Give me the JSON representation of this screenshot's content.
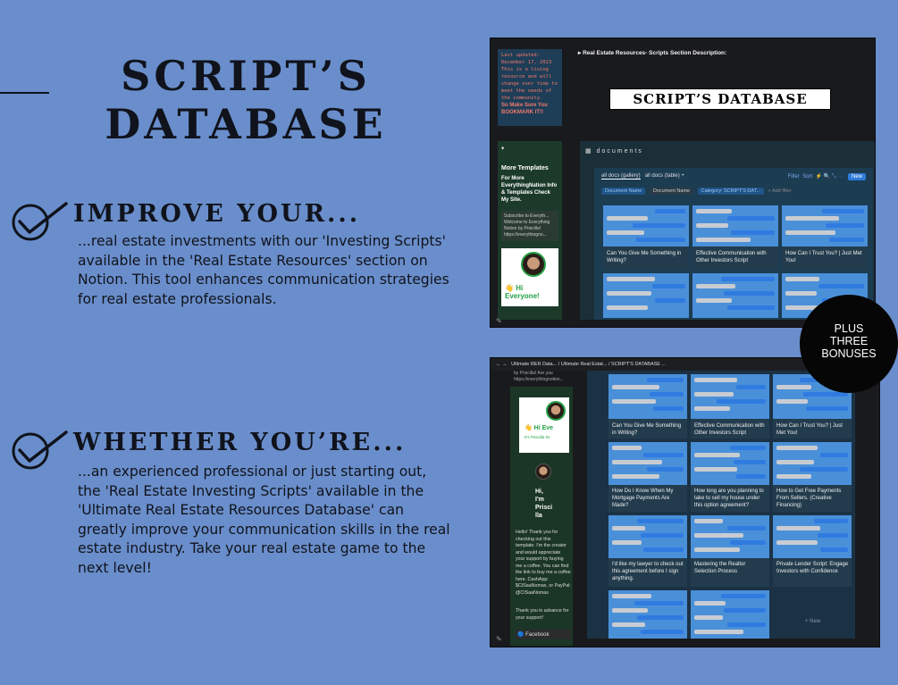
{
  "title_lines": [
    "SCRIPT’S",
    "DATABASE"
  ],
  "features": [
    {
      "heading": "IMPROVE YOUR...",
      "body_lines": [
        "...real estate investments with our 'Investing Scripts'",
        "available in the 'Real Estate Resources' section on",
        "Notion. This tool enhances communication strategies",
        "for real estate professionals."
      ]
    },
    {
      "heading": "WHETHER YOU’RE...",
      "body_lines": [
        "...an experienced professional or just starting out,",
        "the 'Real Estate Investing Scripts' available in the",
        "'Ultimate Real Estate Resources Database' can",
        "greatly improve your communication skills in the real",
        "estate industry. Take your real estate game to the",
        "next level!"
      ]
    }
  ],
  "badge_lines": [
    "PLUS",
    "THREE",
    "BONUSES"
  ],
  "shot1": {
    "notice_lines": [
      "Last updated:",
      "December 17, 2023",
      "This is a living",
      "resource and will",
      "change over time to",
      "meet the needs of",
      "the community.",
      "So Make Sure You",
      "BOOKMARK IT!!"
    ],
    "section_toggle": "Real Estate Resources- Scripts Section Description:",
    "banner": "SCRIPT’S DATABASE",
    "sidebar_heading": "More Templates",
    "sidebar_text": "For More EverythingNation Info & Templates Check My Site.",
    "sidebar_box": [
      "Subscribe to Everyth...",
      "Welcome to Everything",
      "Notion by Priscilla!",
      "https://everythingno..."
    ],
    "sidebar_greeting": "Hi Everyone!",
    "docs_title": "documents",
    "tabs": [
      "all docs (gallery)",
      "all docs (table)"
    ],
    "toolbar": [
      "Filter",
      "Sort"
    ],
    "new_button": "New",
    "filters": [
      "Document Name",
      "Document Name",
      "Category: SCRIPT'S DAT...",
      "+ Add filter"
    ],
    "cards": [
      "Can You Give Me Something in Writing?",
      "Effective Communication with Other Investors Script",
      "How Can I Trust You? | Just Met You!"
    ]
  },
  "shot2": {
    "breadcrumbs": [
      "Ultimate RER Data...",
      "Ultimate Real Estat...",
      "SCRIPT'S DATABASE ..."
    ],
    "side_lines": [
      "by Priscilla! Are you",
      "https://everythingnotion..."
    ],
    "hi_text": [
      "Hi,",
      "I'm",
      "Prisci",
      "lla"
    ],
    "side_greeting": "Hi Eve",
    "side_sub": "It's Priscilla he",
    "thanks": "Hello! Thank you for checking out this template. I'm the creator and would appreciate your support by buying me a coffee. You can find the link to buy me a coffee here. CashApp: $CISaaNomas, or PayPal: @CISaaNomas",
    "thanks_end": "Thank you in advance for your support!",
    "facebook": "Facebook",
    "add_new": "+ New",
    "cards": [
      "Can You Give Me Something in Writing?",
      "Effective Communication with Other Investors Script",
      "How Can I Trust You? | Just Met You!",
      "How Do I Know When My Mortgage Payments Are Made?",
      "How long are you planning to take to sell my house under this option agreement?",
      "How to Get Free Payments From Sellers. (Creative Financing)",
      "I'd like my lawyer to check out this agreement before I sign anything.",
      "Mastering the Realtor Selection Process",
      "Private Lender Script: Engage Investors with Confidence"
    ]
  }
}
